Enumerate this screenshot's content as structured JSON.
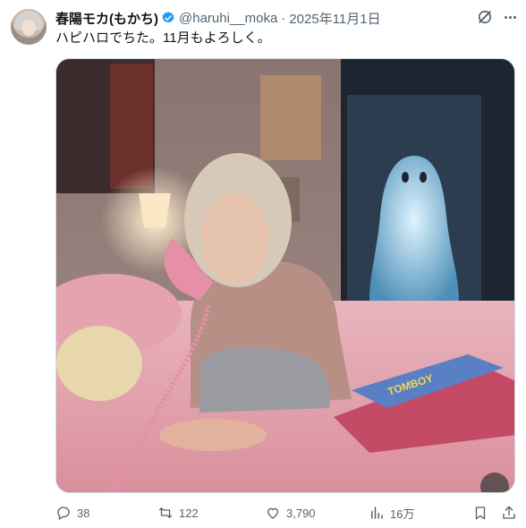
{
  "author": {
    "name": "春陽モカ(もかち)",
    "handle": "@haruhi__moka",
    "separator": "·",
    "date": "2025年11月1日"
  },
  "post": {
    "text": "ハピハロでちた。11月もよろしく。"
  },
  "media": {
    "magazine_label": "TOMBOY"
  },
  "metrics": {
    "replies": "38",
    "reposts": "122",
    "likes": "3,790",
    "views": "16万"
  },
  "colors": {
    "verified": "#1d9bf0",
    "muted": "#536471"
  },
  "icons": [
    "verified-badge-icon",
    "grok-icon",
    "more-icon",
    "reply-icon",
    "repost-icon",
    "like-icon",
    "views-icon",
    "bookmark-icon",
    "share-icon"
  ]
}
